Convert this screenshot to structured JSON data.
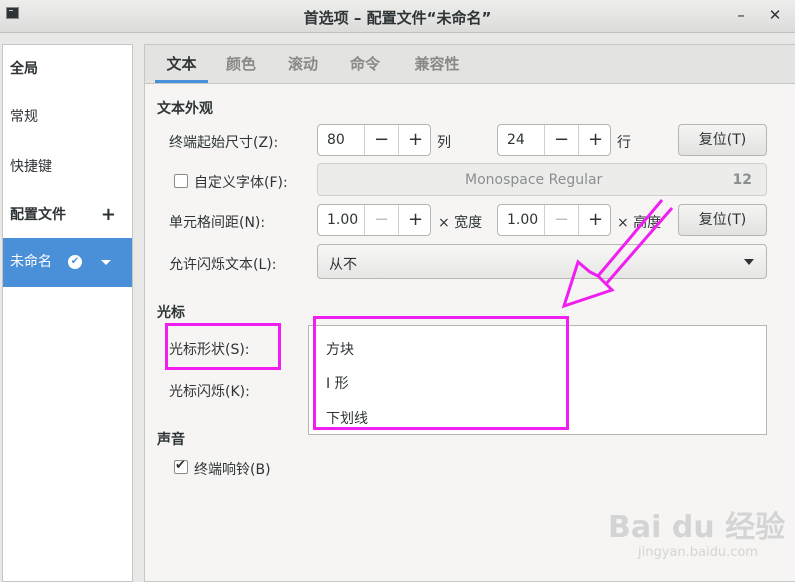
{
  "window": {
    "title": "首选项 – 配置文件“未命名”",
    "minimize_glyph": "–",
    "close_glyph": "✕"
  },
  "sidebar": {
    "global": "全局",
    "general": "常规",
    "shortcuts": "快捷键",
    "profiles": "配置文件",
    "add_glyph": "+",
    "profile_name": "未命名",
    "default_mark": "✔"
  },
  "tabs": [
    "文本",
    "颜色",
    "滚动",
    "命令",
    "兼容性"
  ],
  "text_appearance": {
    "section": "文本外观",
    "size_label": "终端起始尺寸(Z):",
    "columns_value": "80",
    "columns_unit": "列",
    "rows_value": "24",
    "rows_unit": "行",
    "reset_label": "复位(T)",
    "custom_font_label": "自定义字体(F):",
    "custom_font_checked": false,
    "font_name": "Monospace Regular",
    "font_size": "12",
    "spacing_label": "单元格间距(N):",
    "width_value": "1.00",
    "width_unit": "× 宽度",
    "height_value": "1.00",
    "height_unit": "× 高度",
    "reset2_label": "复位(T)",
    "blink_label": "允许闪烁文本(L):",
    "blink_value": "从不"
  },
  "cursor": {
    "section": "光标",
    "shape_label": "光标形状(S):",
    "blink_label": "光标闪烁(K):",
    "shape_options": [
      "方块",
      "I 形",
      "下划线"
    ]
  },
  "sound": {
    "section": "声音",
    "bell_label": "终端响铃(B)",
    "bell_checked": true
  },
  "spin_glyphs": {
    "minus": "−",
    "plus": "+"
  },
  "annotation_color": "#f01ef0",
  "watermark": {
    "brand": "Bai du 经验",
    "url": "jingyan.baidu.com"
  }
}
